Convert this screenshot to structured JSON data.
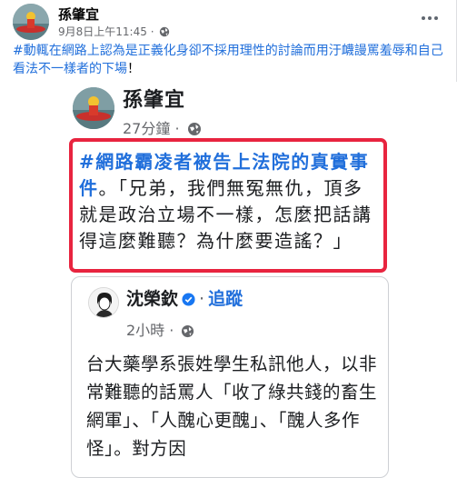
{
  "post": {
    "author": "孫肇宜",
    "timestamp": "9月8日上午11:45",
    "separator": "·",
    "audience_icon": "globe-icon",
    "more_icon": "more-horizontal-icon",
    "hashtag": "#動輒在網路上認為是正義化身卻不採用理性的討論而用汙衊謾罵羞辱和自己看法不一樣者的下場",
    "text_suffix": "！"
  },
  "shared": {
    "author": "孫肇宜",
    "time": "27分鐘",
    "separator": "·",
    "audience_icon": "globe-icon",
    "highlight_hashtag": "#網路霸凌者被告上法院的真實事件",
    "highlight_text": "。「兄弟，我們無冤無仇，頂多就是政治立場不一樣，怎麼把話講得這麼難聽？為什麼要造謠？」",
    "highlight_border_color": "#e8243f"
  },
  "nested": {
    "author": "沈榮欽",
    "verified_icon": "verified-badge-icon",
    "separator": "·",
    "follow_label": "追蹤",
    "time": "2小時",
    "meta_separator": "·",
    "audience_icon": "globe-icon",
    "body": "台大藥學系張姓學生私訊他人，以非常難聽的話罵人「收了綠共錢的畜生網軍」、「人醜心更醜」、「醜人多作怪」。對方因"
  },
  "colors": {
    "link": "#216fdb",
    "secondary_text": "#65676b",
    "primary_text": "#050505"
  }
}
